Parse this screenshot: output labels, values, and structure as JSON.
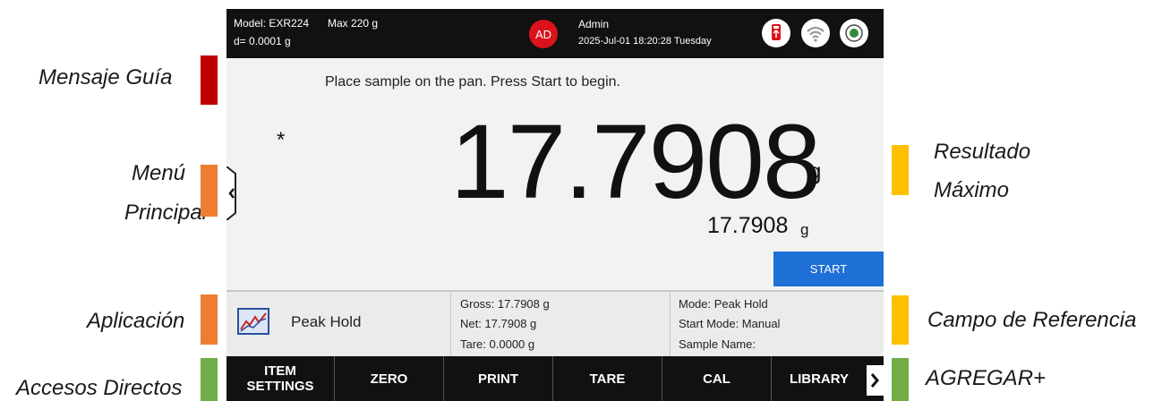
{
  "callouts": {
    "mensaje_guia": "Mensaje Guía",
    "menu_principal_line1": "Menú",
    "menu_principal_line2": "Principal",
    "aplicacion": "Aplicación",
    "accesos_directos": "Accesos Directos",
    "resultado_maximo_line1": "Resultado",
    "resultado_maximo_line2": "Máximo",
    "campo_referencia": "Campo de Referencia",
    "agregar": "AGREGAR+"
  },
  "callout_colors": {
    "red": "#c00000",
    "orange": "#ed7d31",
    "yellow": "#ffc000",
    "green": "#70ad47"
  },
  "status_bar": {
    "model": "Model: EXR224",
    "max": "Max 220 g",
    "readability": "d= 0.0001 g",
    "user_initials": "AD",
    "user_name": "Admin",
    "datetime": "2025-Jul-01 18:20:28 Tuesday",
    "icons": [
      "usb-icon",
      "wifi-icon",
      "level-bubble-icon"
    ]
  },
  "main": {
    "guide_message": "Place sample on the pan.  Press Start to begin.",
    "stability_marker": "*",
    "weight": "17.7908",
    "weight_unit": "g",
    "peak_value": "17.7908",
    "peak_unit": "g",
    "start_label": "START"
  },
  "application": {
    "name": "Peak Hold",
    "icon": "peak-hold-chart-icon"
  },
  "reference": {
    "gross": "Gross: 17.7908 g",
    "net": "Net: 17.7908 g",
    "tare": "Tare: 0.0000 g",
    "mode": "Mode: Peak Hold",
    "start_mode": "Start Mode: Manual",
    "sample_name": "Sample Name:"
  },
  "shortcuts": [
    {
      "line1": "ITEM",
      "line2": "SETTINGS"
    },
    {
      "line1": "ZERO",
      "line2": ""
    },
    {
      "line1": "PRINT",
      "line2": ""
    },
    {
      "line1": "TARE",
      "line2": ""
    },
    {
      "line1": "CAL",
      "line2": ""
    },
    {
      "line1": "LIBRARY",
      "line2": ""
    }
  ],
  "colors": {
    "accent_blue": "#1e6fd6",
    "avatar_red": "#d9121c",
    "bar_black": "#111111"
  }
}
